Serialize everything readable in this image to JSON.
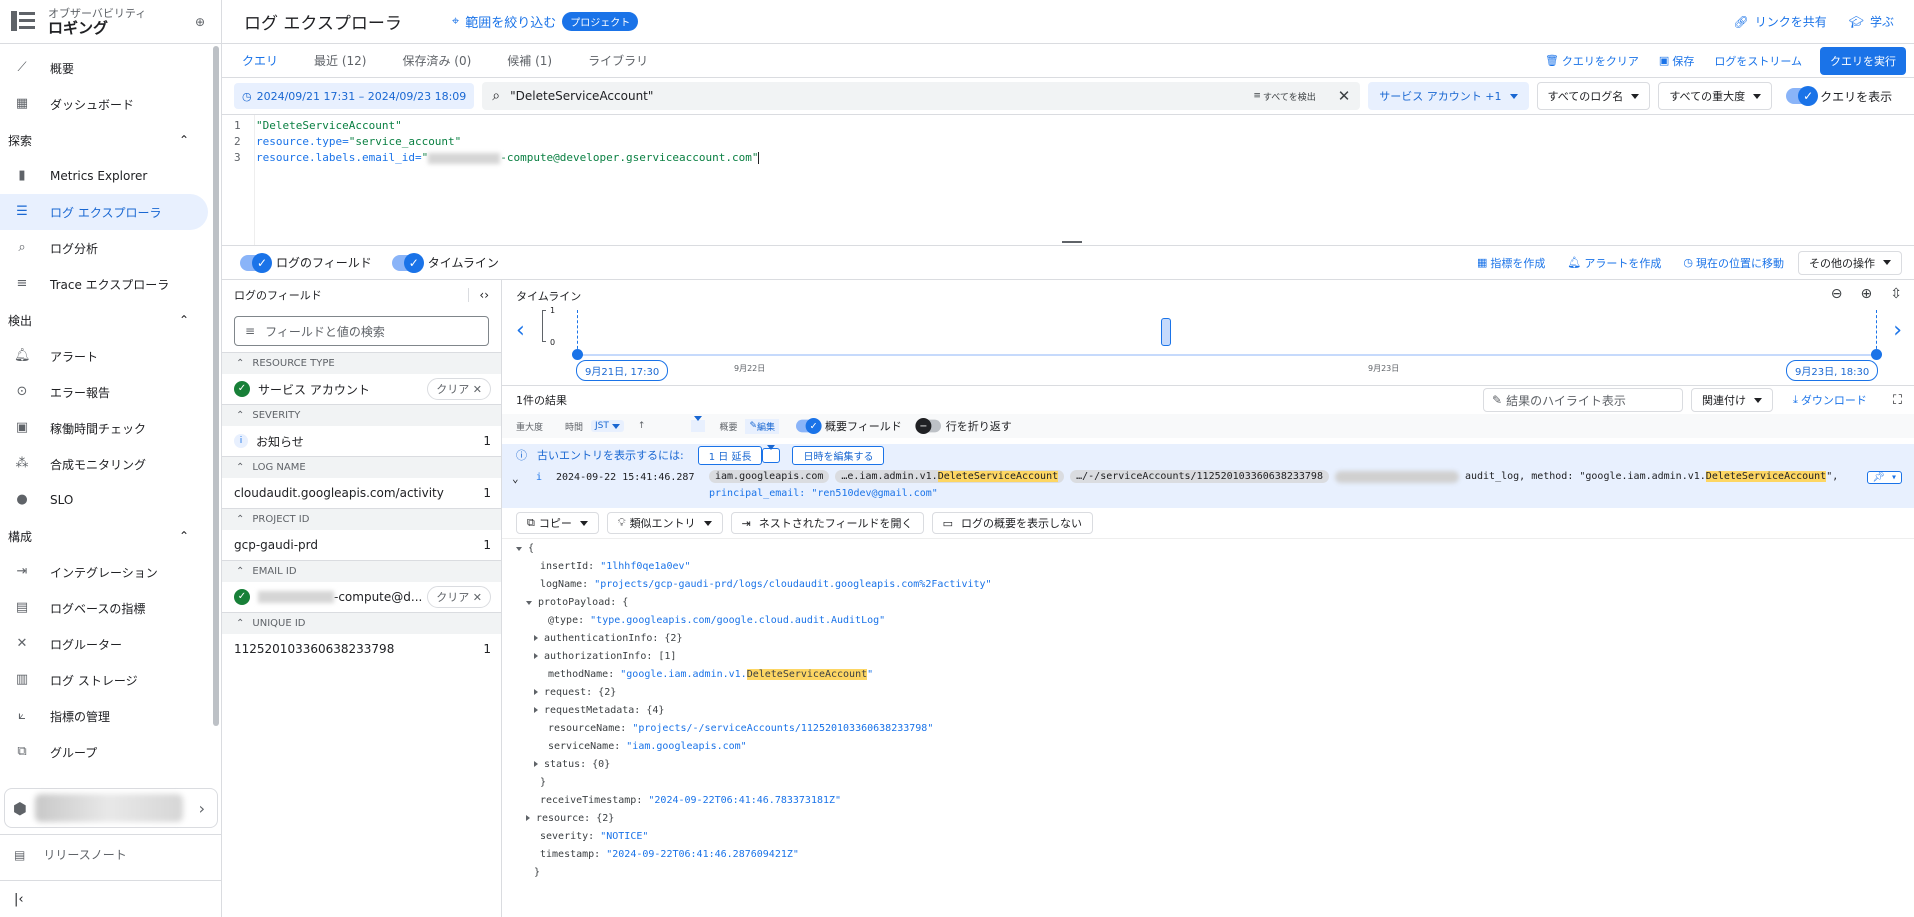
{
  "sidebar": {
    "subtitle": "オブザーバビリティ",
    "title": "ロギング",
    "items_top": [
      {
        "label": "概要",
        "icon": "chart-line-icon"
      },
      {
        "label": "ダッシュボード",
        "icon": "dashboard-icon"
      }
    ],
    "section_explore": "探索",
    "items_explore": [
      {
        "label": "Metrics Explorer",
        "icon": "bar-chart-icon"
      },
      {
        "label": "ログ エクスプローラ",
        "icon": "list-icon"
      },
      {
        "label": "ログ分析",
        "icon": "search-list-icon"
      },
      {
        "label": "Trace エクスプローラ",
        "icon": "trace-icon"
      }
    ],
    "section_detect": "検出",
    "items_detect": [
      {
        "label": "アラート",
        "icon": "bell-icon"
      },
      {
        "label": "エラー報告",
        "icon": "error-icon"
      },
      {
        "label": "稼働時間チェック",
        "icon": "monitor-icon"
      },
      {
        "label": "合成モニタリング",
        "icon": "network-icon"
      },
      {
        "label": "SLO",
        "icon": "slo-icon"
      }
    ],
    "section_config": "構成",
    "items_config": [
      {
        "label": "インテグレーション",
        "icon": "integration-icon"
      },
      {
        "label": "ログベースの指標",
        "icon": "log-metric-icon"
      },
      {
        "label": "ログルーター",
        "icon": "router-icon"
      },
      {
        "label": "ログ ストレージ",
        "icon": "storage-icon"
      },
      {
        "label": "指標の管理",
        "icon": "metrics-manage-icon"
      },
      {
        "label": "グループ",
        "icon": "group-icon"
      }
    ],
    "release_notes": "リリースノート"
  },
  "topbar": {
    "page_title": "ログ エクスプローラ",
    "scope_label": "範囲を絞り込む",
    "project_chip": "プロジェクト",
    "share_link": "リンクを共有",
    "learn": "学ぶ"
  },
  "tabs": {
    "items": [
      "クエリ",
      "最近 (12)",
      "保存済み (0)",
      "候補 (1)",
      "ライブラリ"
    ],
    "clear_query": "クエリをクリア",
    "save": "保存",
    "stream_logs": "ログをストリーム",
    "run_query": "クエリを実行"
  },
  "filter": {
    "date_range": "2024/09/21 17:31 – 2024/09/23 18:09",
    "search_value": "\"DeleteServiceAccount\"",
    "detect_all": "すべてを検出",
    "service_account": "サービス アカウント +1",
    "all_log_names": "すべてのログ名",
    "all_severity": "すべての重大度",
    "show_query": "クエリを表示"
  },
  "editor": {
    "line1_num": "1",
    "line2_num": "2",
    "line3_num": "3",
    "line1": "\"DeleteServiceAccount\"",
    "line2_key": "resource.type=",
    "line2_val": "\"service_account\"",
    "line3_key": "resource.labels.email_id=",
    "line3_val_suffix": "-compute@developer.gserviceaccount.com\""
  },
  "panels": {
    "log_fields": "ログのフィールド",
    "timeline": "タイムライン",
    "create_metric": "指標を作成",
    "create_alert": "アラートを作成",
    "jump_now": "現在の位置に移動",
    "more_actions": "その他の操作"
  },
  "fields": {
    "header": "ログのフィールド",
    "search_placeholder": "フィールドと値の検索",
    "clear": "クリア",
    "sections": [
      {
        "name": "RESOURCE TYPE"
      },
      {
        "name": "SEVERITY"
      },
      {
        "name": "LOG NAME"
      },
      {
        "name": "PROJECT ID"
      },
      {
        "name": "EMAIL ID"
      },
      {
        "name": "UNIQUE ID"
      }
    ],
    "resource_type_value": "サービス アカウント",
    "severity_value": "お知らせ",
    "severity_count": "1",
    "log_name_value": "cloudaudit.googleapis.com/activity",
    "log_name_count": "1",
    "project_id_value": "gcp-gaudi-prd",
    "project_id_count": "1",
    "email_id_suffix": "-compute@d...",
    "unique_id_value": "112520103360638233798",
    "unique_id_count": "1"
  },
  "timeline": {
    "title": "タイムライン",
    "y_max": "1",
    "y_min": "0",
    "start_chip": "9月21日, 17:30",
    "end_chip": "9月23日, 18:30",
    "tick_1": "9月22日",
    "tick_2": "9月23日",
    "bar_count": 1
  },
  "results": {
    "count": "1件の結果",
    "highlight_placeholder": "結果のハイライト表示",
    "related": "関連付け",
    "download": "ダウンロード",
    "col_severity": "重大度",
    "col_time": "時間",
    "col_tz": "JST",
    "col_summary": "概要",
    "col_edit": "編集",
    "summary_fields": "概要フィールド",
    "wrap_lines": "行を折り返す",
    "older_entries": "古いエントリを表示するには:",
    "extend_1day": "1 日 延長",
    "edit_time": "日時を編集する",
    "entry": {
      "timestamp": "2024-09-22 15:41:46.287",
      "chip1": "iam.googleapis.com",
      "chip2_prefix": "…e.iam.admin.v1.",
      "chip2_hl": "DeleteServiceAccount",
      "chip3": "…/-/serviceAccounts/112520103360638233798",
      "summary_prefix": "audit_log, method: \"google.iam.admin.v1.",
      "summary_hl": "DeleteServiceAccount",
      "summary_suffix": "\",",
      "line2": "principal_email: \"ren510dev@gmail.com\""
    },
    "actions": [
      "コピー",
      "類似エントリ",
      "ネストされたフィールドを開く",
      "ログの概要を表示しない"
    ],
    "tree": {
      "open_brace": "{",
      "insertId_key": "insertId:",
      "insertId_val": "\"1lhhf0qe1a0ev\"",
      "logName_key": "logName:",
      "logName_val": "\"projects/gcp-gaudi-prd/logs/cloudaudit.googleapis.com%2Factivity\"",
      "protoPayload_key": "protoPayload: {",
      "type_key": "@type:",
      "type_val": "\"type.googleapis.com/google.cloud.audit.AuditLog\"",
      "authn": "authenticationInfo: {2}",
      "authz": "authorizationInfo: [1]",
      "method_key": "methodName:",
      "method_val_prefix": "\"google.iam.admin.v1.",
      "method_val_hl": "DeleteServiceAccount",
      "method_val_suffix": "\"",
      "request": "request: {2}",
      "reqmeta": "requestMetadata: {4}",
      "resName_key": "resourceName:",
      "resName_val": "\"projects/-/serviceAccounts/112520103360638233798\"",
      "svcName_key": "serviceName:",
      "svcName_val": "\"iam.googleapis.com\"",
      "status": "status: {0}",
      "close_inner": "}",
      "recvTs_key": "receiveTimestamp:",
      "recvTs_val": "\"2024-09-22T06:41:46.783373181Z\"",
      "resource": "resource: {2}",
      "severity_key": "severity:",
      "severity_val": "\"NOTICE\"",
      "ts_key": "timestamp:",
      "ts_val": "\"2024-09-22T06:41:46.287609421Z\"",
      "close_outer": "}"
    }
  }
}
